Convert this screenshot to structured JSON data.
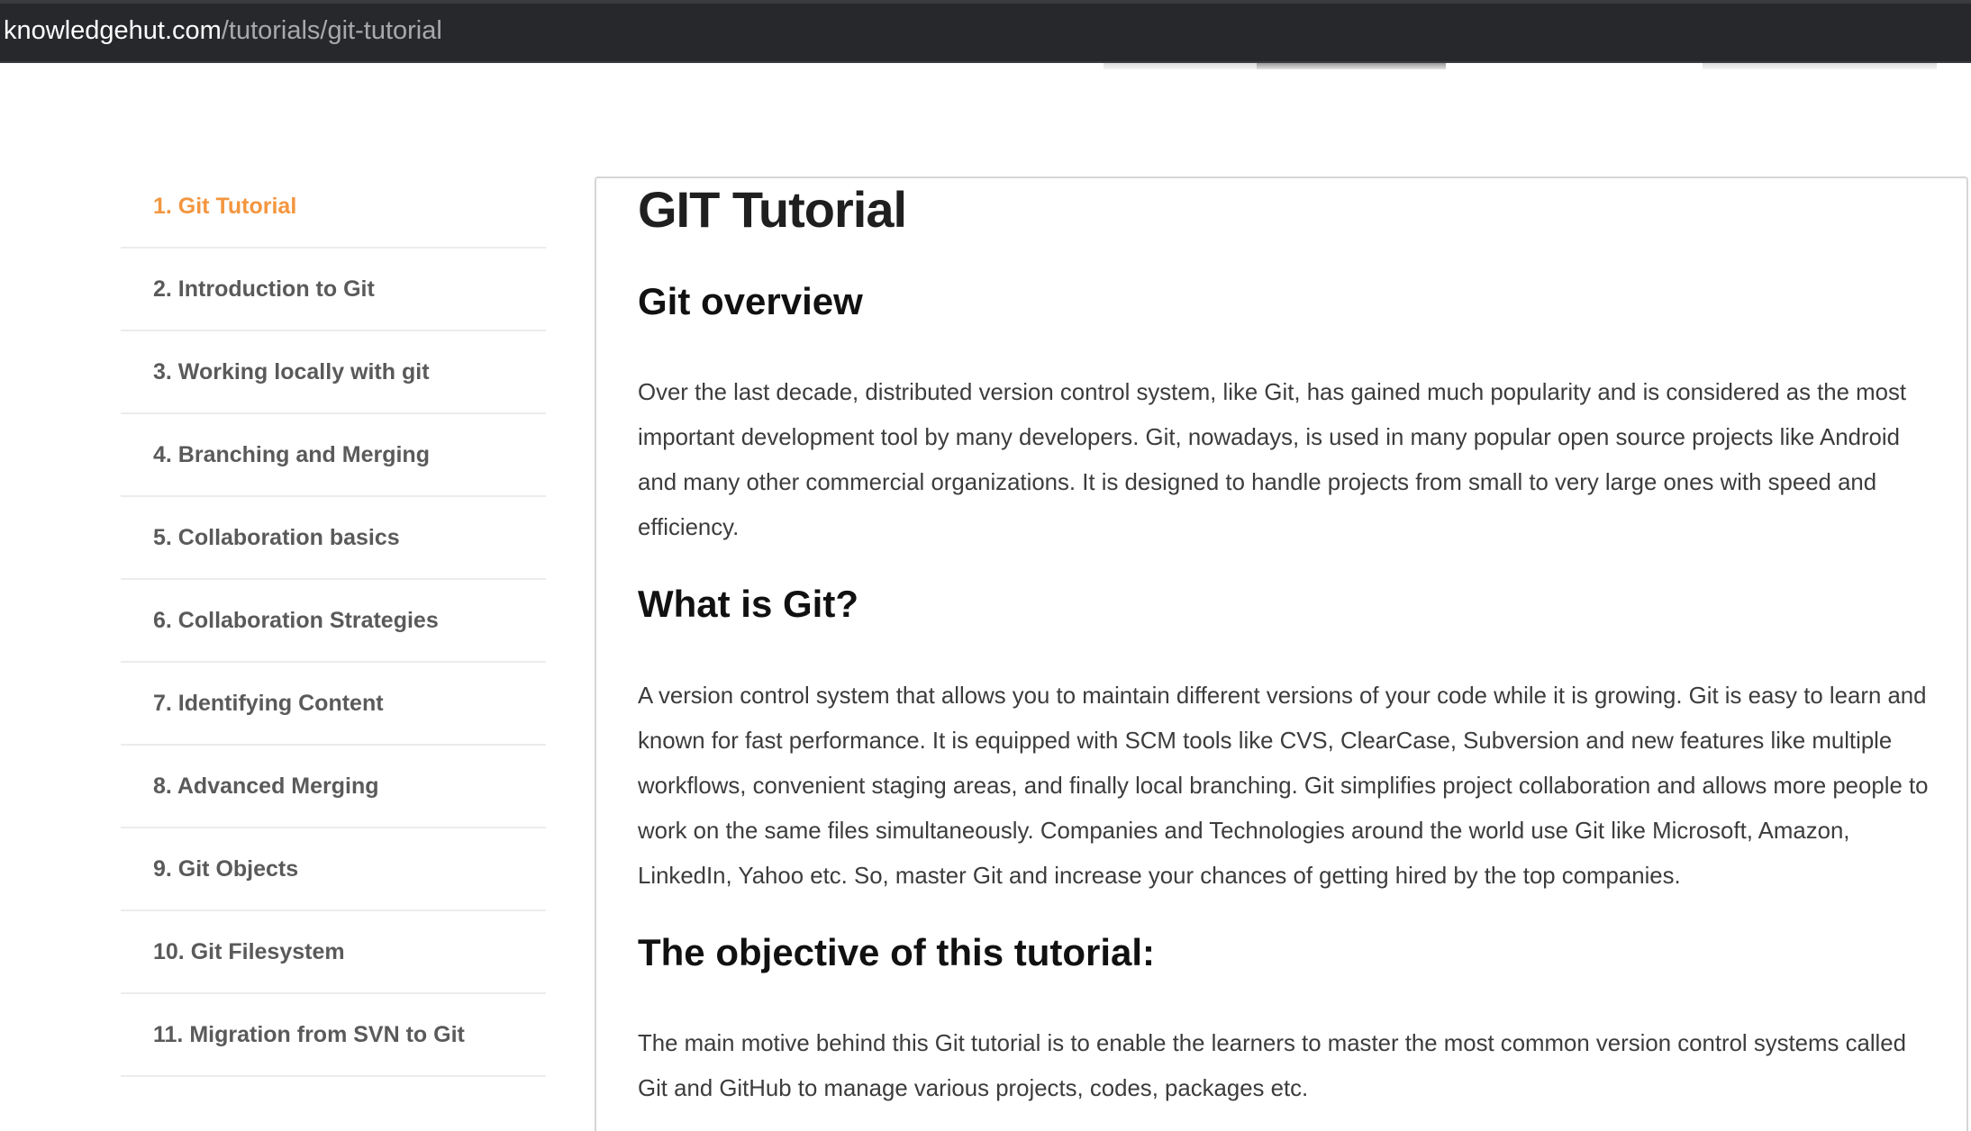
{
  "browser": {
    "url_host": "knowledgehut.com",
    "url_path": "/tutorials/git-tutorial"
  },
  "colors": {
    "accent": "#f3963f",
    "sidebar_text": "#5a5a5a",
    "address_bar": "#27282c"
  },
  "sidebar": {
    "items": [
      {
        "label": "1. Git Tutorial",
        "active": true
      },
      {
        "label": "2. Introduction to Git",
        "active": false
      },
      {
        "label": "3. Working locally with git",
        "active": false
      },
      {
        "label": "4. Branching and Merging",
        "active": false
      },
      {
        "label": "5. Collaboration basics",
        "active": false
      },
      {
        "label": "6. Collaboration Strategies",
        "active": false
      },
      {
        "label": "7. Identifying Content",
        "active": false
      },
      {
        "label": "8. Advanced Merging",
        "active": false
      },
      {
        "label": "9. Git Objects",
        "active": false
      },
      {
        "label": "10. Git Filesystem",
        "active": false
      },
      {
        "label": "11. Migration from SVN to Git",
        "active": false
      }
    ]
  },
  "main": {
    "title": "GIT Tutorial",
    "sections": [
      {
        "heading": "Git overview",
        "body": "Over the last decade, distributed version control system, like Git, has gained much popularity and is considered as the most important development tool by many developers. Git, nowadays, is used in many popular open source projects like Android and many other commercial organizations. It is designed to handle projects from small to very large ones with speed and efficiency."
      },
      {
        "heading": "What is Git?",
        "body": "A version control system that allows you to maintain different versions of your code while it is growing. Git is easy to learn and known for fast performance. It is equipped with SCM tools like CVS, ClearCase, Subversion and new features like multiple workflows, convenient staging areas, and finally local branching. Git simplifies project collaboration and allows more people to work on the same files simultaneously. Companies and Technologies around the world use Git like Microsoft, Amazon, LinkedIn, Yahoo etc. So, master Git and increase your chances of getting hired by the top companies."
      },
      {
        "heading": "The objective of this tutorial:",
        "body": "The main motive behind this Git tutorial is to enable the learners to master the most common version control systems called Git and GitHub to manage various projects, codes, packages etc."
      }
    ]
  }
}
